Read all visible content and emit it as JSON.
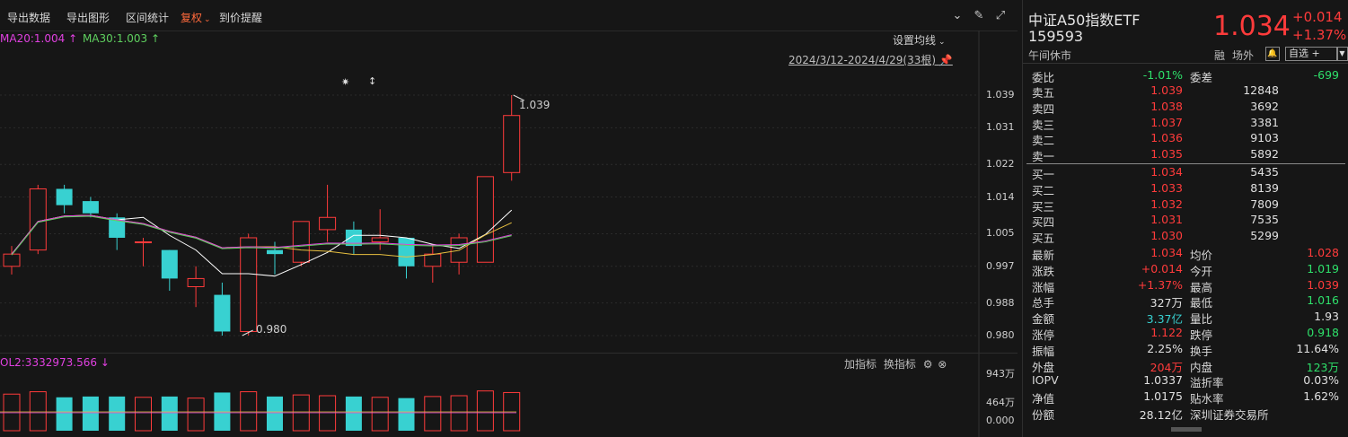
{
  "toolbar": {
    "export_data": "导出数据",
    "export_chart": "导出图形",
    "range_stats": "区间统计",
    "adjust": "复权",
    "price_alert": "到价提醒"
  },
  "chart": {
    "ma20": "MA20:1.004",
    "ma30": "MA30:1.003",
    "arrow_up": "↑",
    "set_ma": "设置均线",
    "date_range": "2024/3/12-2024/4/29(33根)",
    "high_label": "1.039",
    "low_label": "0.980",
    "vol_label": "OL2:3332973.566",
    "vol_arrow": "↓",
    "add_indicator": "加指标",
    "switch_indicator": "换指标"
  },
  "chart_data": [
    {
      "type": "candlestick",
      "y_ticks": [
        "1.039",
        "1.031",
        "1.022",
        "1.014",
        "1.005",
        "0.997",
        "0.988",
        "0.980"
      ],
      "ylim": [
        0.98,
        1.039
      ],
      "candles": [
        {
          "open": 0.997,
          "close": 1.0,
          "high": 1.002,
          "low": 0.995
        },
        {
          "open": 1.001,
          "close": 1.016,
          "high": 1.017,
          "low": 1.0
        },
        {
          "open": 1.016,
          "close": 1.012,
          "high": 1.017,
          "low": 1.01
        },
        {
          "open": 1.013,
          "close": 1.01,
          "high": 1.014,
          "low": 1.009
        },
        {
          "open": 1.009,
          "close": 1.004,
          "high": 1.01,
          "low": 1.001
        },
        {
          "open": 1.003,
          "close": 1.003,
          "high": 1.004,
          "low": 0.997
        },
        {
          "open": 1.001,
          "close": 0.994,
          "high": 1.001,
          "low": 0.991
        },
        {
          "open": 0.992,
          "close": 0.994,
          "high": 0.997,
          "low": 0.987
        },
        {
          "open": 0.99,
          "close": 0.981,
          "high": 0.993,
          "low": 0.98
        },
        {
          "open": 0.981,
          "close": 1.004,
          "high": 1.005,
          "low": 0.98
        },
        {
          "open": 1.001,
          "close": 1.0,
          "high": 1.003,
          "low": 0.995
        },
        {
          "open": 0.998,
          "close": 1.008,
          "high": 1.008,
          "low": 0.997
        },
        {
          "open": 1.006,
          "close": 1.009,
          "high": 1.017,
          "low": 1.003
        },
        {
          "open": 1.006,
          "close": 1.002,
          "high": 1.008,
          "low": 1.0
        },
        {
          "open": 1.003,
          "close": 1.004,
          "high": 1.011,
          "low": 1.001
        },
        {
          "open": 1.004,
          "close": 0.997,
          "high": 1.004,
          "low": 0.994
        },
        {
          "open": 0.997,
          "close": 1.0,
          "high": 1.002,
          "low": 0.993
        },
        {
          "open": 0.998,
          "close": 1.004,
          "high": 1.005,
          "low": 0.995
        },
        {
          "open": 0.998,
          "close": 1.019,
          "high": 1.019,
          "low": 0.998
        },
        {
          "open": 1.02,
          "close": 1.034,
          "high": 1.039,
          "low": 1.018
        }
      ]
    },
    {
      "type": "bar",
      "y_ticks": [
        "943万",
        "464万",
        "0.000"
      ],
      "values": [
        4.6,
        4.9,
        4.2,
        4.3,
        4.3,
        4.2,
        4.3,
        4.1,
        4.8,
        4.9,
        4.3,
        4.5,
        4.4,
        4.3,
        4.2,
        4.1,
        4.3,
        4.4,
        5.0,
        4.8
      ]
    }
  ],
  "panel": {
    "name": "中证A50指数ETF",
    "code": "159593",
    "price": "1.034",
    "change": "+0.014",
    "change_pct": "+1.37%",
    "rong": "融",
    "offmarket": "场外",
    "status": "午间休市",
    "watchlist": "自选 +",
    "weibi_label": "委比",
    "weibi_val": "-1.01%",
    "weicha_label": "委差",
    "weicha_val": "-699",
    "asks": [
      {
        "label": "卖五",
        "price": "1.039",
        "vol": "12848"
      },
      {
        "label": "卖四",
        "price": "1.038",
        "vol": "3692"
      },
      {
        "label": "卖三",
        "price": "1.037",
        "vol": "3381"
      },
      {
        "label": "卖二",
        "price": "1.036",
        "vol": "9103"
      },
      {
        "label": "卖一",
        "price": "1.035",
        "vol": "5892"
      }
    ],
    "bids": [
      {
        "label": "买一",
        "price": "1.034",
        "vol": "5435"
      },
      {
        "label": "买二",
        "price": "1.033",
        "vol": "8139"
      },
      {
        "label": "买三",
        "price": "1.032",
        "vol": "7809"
      },
      {
        "label": "买四",
        "price": "1.031",
        "vol": "7535"
      },
      {
        "label": "买五",
        "price": "1.030",
        "vol": "5299"
      }
    ],
    "stats": [
      {
        "l1": "最新",
        "v1": "1.034",
        "c1": "red",
        "l2": "均价",
        "v2": "1.028",
        "c2": "red"
      },
      {
        "l1": "涨跌",
        "v1": "+0.014",
        "c1": "red",
        "l2": "今开",
        "v2": "1.019",
        "c2": "green"
      },
      {
        "l1": "涨幅",
        "v1": "+1.37%",
        "c1": "red",
        "l2": "最高",
        "v2": "1.039",
        "c2": "red"
      },
      {
        "l1": "总手",
        "v1": "327万",
        "c1": "white",
        "l2": "最低",
        "v2": "1.016",
        "c2": "green"
      },
      {
        "l1": "金额",
        "v1": "3.37亿",
        "c1": "cyan",
        "l2": "量比",
        "v2": "1.93",
        "c2": "white"
      },
      {
        "l1": "涨停",
        "v1": "1.122",
        "c1": "red",
        "l2": "跌停",
        "v2": "0.918",
        "c2": "green"
      },
      {
        "l1": "振幅",
        "v1": "2.25%",
        "c1": "white",
        "l2": "换手",
        "v2": "11.64%",
        "c2": "white"
      },
      {
        "l1": "外盘",
        "v1": "204万",
        "c1": "red",
        "l2": "内盘",
        "v2": "123万",
        "c2": "green"
      },
      {
        "l1": "IOPV",
        "v1": "1.0337",
        "c1": "white",
        "l2": "溢折率",
        "v2": "0.03%",
        "c2": "white"
      },
      {
        "l1": "净值",
        "v1": "1.0175",
        "c1": "white",
        "l2": "贴水率",
        "v2": "1.62%",
        "c2": "white"
      },
      {
        "l1": "份额",
        "v1": "28.12亿",
        "c1": "white",
        "l2": "深圳证券交易所",
        "v2": "",
        "c2": "white"
      }
    ]
  }
}
